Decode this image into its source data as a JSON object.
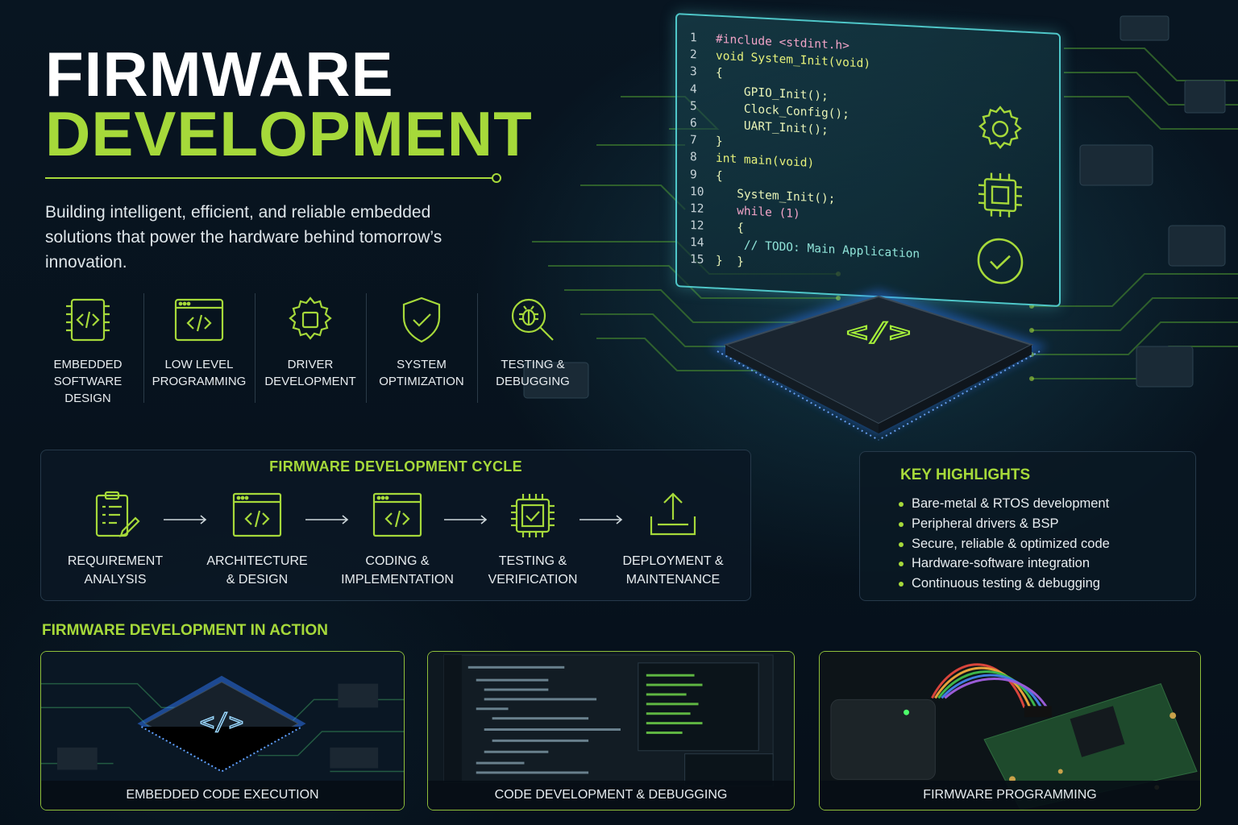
{
  "title": {
    "line1": "FIRMWARE",
    "line2": "DEVELOPMENT"
  },
  "subtitle": "Building intelligent, efficient, and reliable embedded solutions that power the hardware behind tomorrow’s innovation.",
  "services": [
    {
      "label": "EMBEDDED\nSOFTWARE\nDESIGN",
      "icon": "chip-code-icon"
    },
    {
      "label": "LOW LEVEL\nPROGRAMMING",
      "icon": "code-window-icon"
    },
    {
      "label": "DRIVER\nDEVELOPMENT",
      "icon": "gear-chip-icon"
    },
    {
      "label": "SYSTEM\nOPTIMIZATION",
      "icon": "shield-check-icon"
    },
    {
      "label": "TESTING &\nDEBUGGING",
      "icon": "bug-magnifier-icon"
    }
  ],
  "code_panel": {
    "lines": [
      {
        "n": "1",
        "text": "#include <stdint.h>"
      },
      {
        "n": "2",
        "text": "void System_Init(void)"
      },
      {
        "n": "3",
        "text": "{"
      },
      {
        "n": "4",
        "text": "    GPIO_Init();"
      },
      {
        "n": "5",
        "text": "    Clock_Config();"
      },
      {
        "n": "6",
        "text": "    UART_Init();"
      },
      {
        "n": "7",
        "text": "}"
      },
      {
        "n": "8",
        "text": "int main(void)"
      },
      {
        "n": "9",
        "text": "{"
      },
      {
        "n": "10",
        "text": "   System_Init();"
      },
      {
        "n": "12",
        "text": "   while (1)"
      },
      {
        "n": "12",
        "text": "   {"
      },
      {
        "n": "14",
        "text": "    // TODO: Main Application"
      },
      {
        "n": "15",
        "text": "}  }"
      }
    ],
    "icons": [
      "gear-icon",
      "chip-icon",
      "check-circle-icon"
    ]
  },
  "chip": {
    "symbol": "</>"
  },
  "cycle": {
    "title": "FIRMWARE DEVELOPMENT CYCLE",
    "steps": [
      {
        "label": "REQUIREMENT\nANALYSIS",
        "icon": "clipboard-pen-icon"
      },
      {
        "label": "ARCHITECTURE\n& DESIGN",
        "icon": "code-window-icon"
      },
      {
        "label": "CODING &\nIMPLEMENTATION",
        "icon": "code-window-icon"
      },
      {
        "label": "TESTING &\nVERIFICATION",
        "icon": "chip-check-icon"
      },
      {
        "label": "DEPLOYMENT &\nMAINTENANCE",
        "icon": "upload-tray-icon"
      }
    ]
  },
  "highlights": {
    "title": "KEY HIGHLIGHTS",
    "items": [
      "Bare-metal & RTOS development",
      "Peripheral drivers & BSP",
      "Secure, reliable & optimized code",
      "Hardware-software integration",
      "Continuous testing & debugging"
    ]
  },
  "action": {
    "title": "FIRMWARE DEVELOPMENT IN ACTION",
    "cards": [
      {
        "caption": "EMBEDDED CODE EXECUTION"
      },
      {
        "caption": "CODE DEVELOPMENT & DEBUGGING"
      },
      {
        "caption": "FIRMWARE PROGRAMMING"
      }
    ]
  },
  "colors": {
    "accent": "#a6d93a",
    "glow_cyan": "#4fc7c9",
    "glow_blue": "#2f7bff",
    "background": "#07121c"
  }
}
